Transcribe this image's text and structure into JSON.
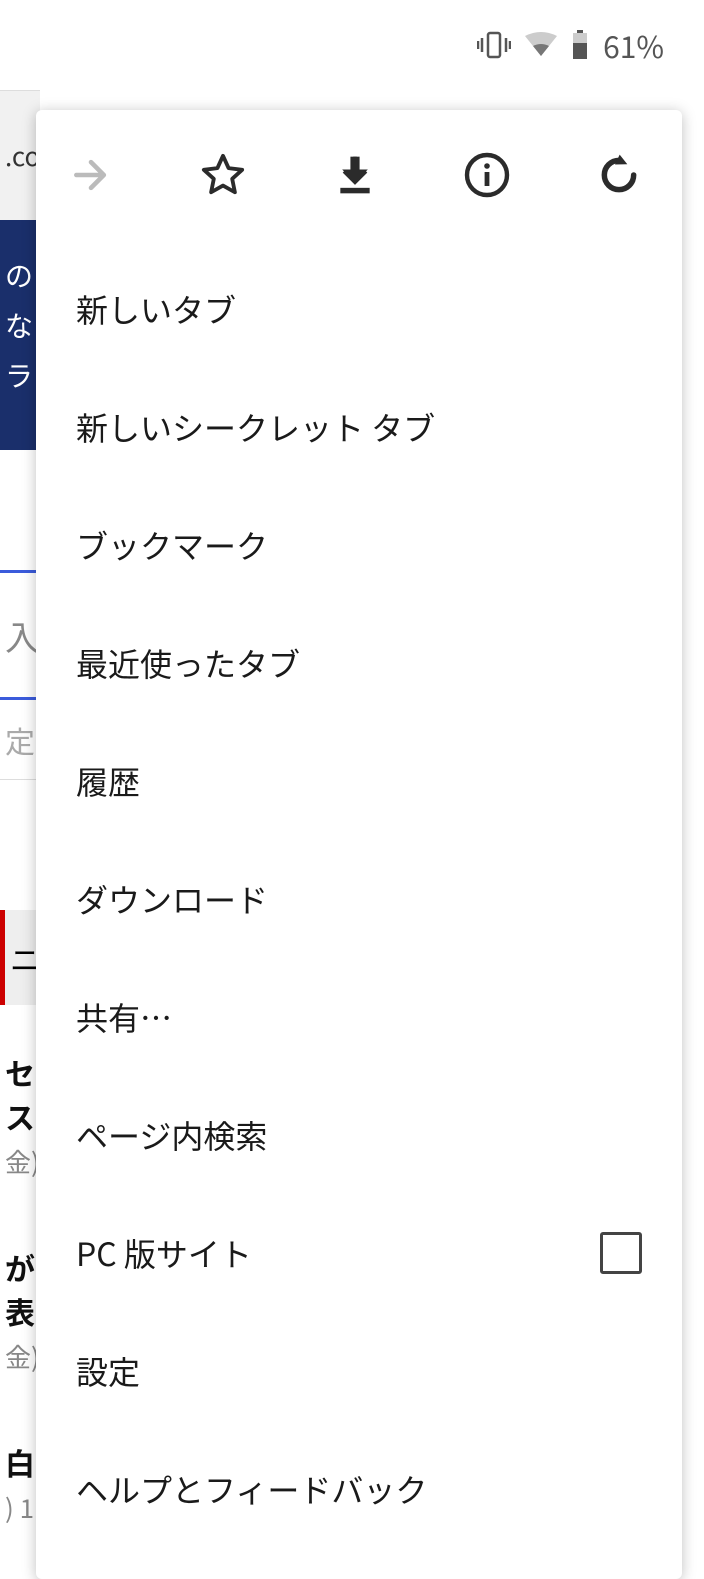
{
  "status_bar": {
    "battery_percent": "61%"
  },
  "background": {
    "url_fragment": ".co",
    "banner_line1": "の",
    "banner_line2": "な",
    "banner_line3": "ラ",
    "search_placeholder": "入",
    "setting_label": "定",
    "news_label": "ニ",
    "article1_title": "セス",
    "article1_date": "金)",
    "article2_title": "が表",
    "article2_date": "金)",
    "article3_title": "白",
    "article3_date": ") 1"
  },
  "menu": {
    "items": {
      "new_tab": "新しいタブ",
      "new_incognito": "新しいシークレット タブ",
      "bookmarks": "ブックマーク",
      "recent_tabs": "最近使ったタブ",
      "history": "履歴",
      "downloads": "ダウンロード",
      "share": "共有…",
      "find_in_page": "ページ内検索",
      "desktop_site": "PC 版サイト",
      "settings": "設定",
      "help": "ヘルプとフィードバック"
    }
  }
}
